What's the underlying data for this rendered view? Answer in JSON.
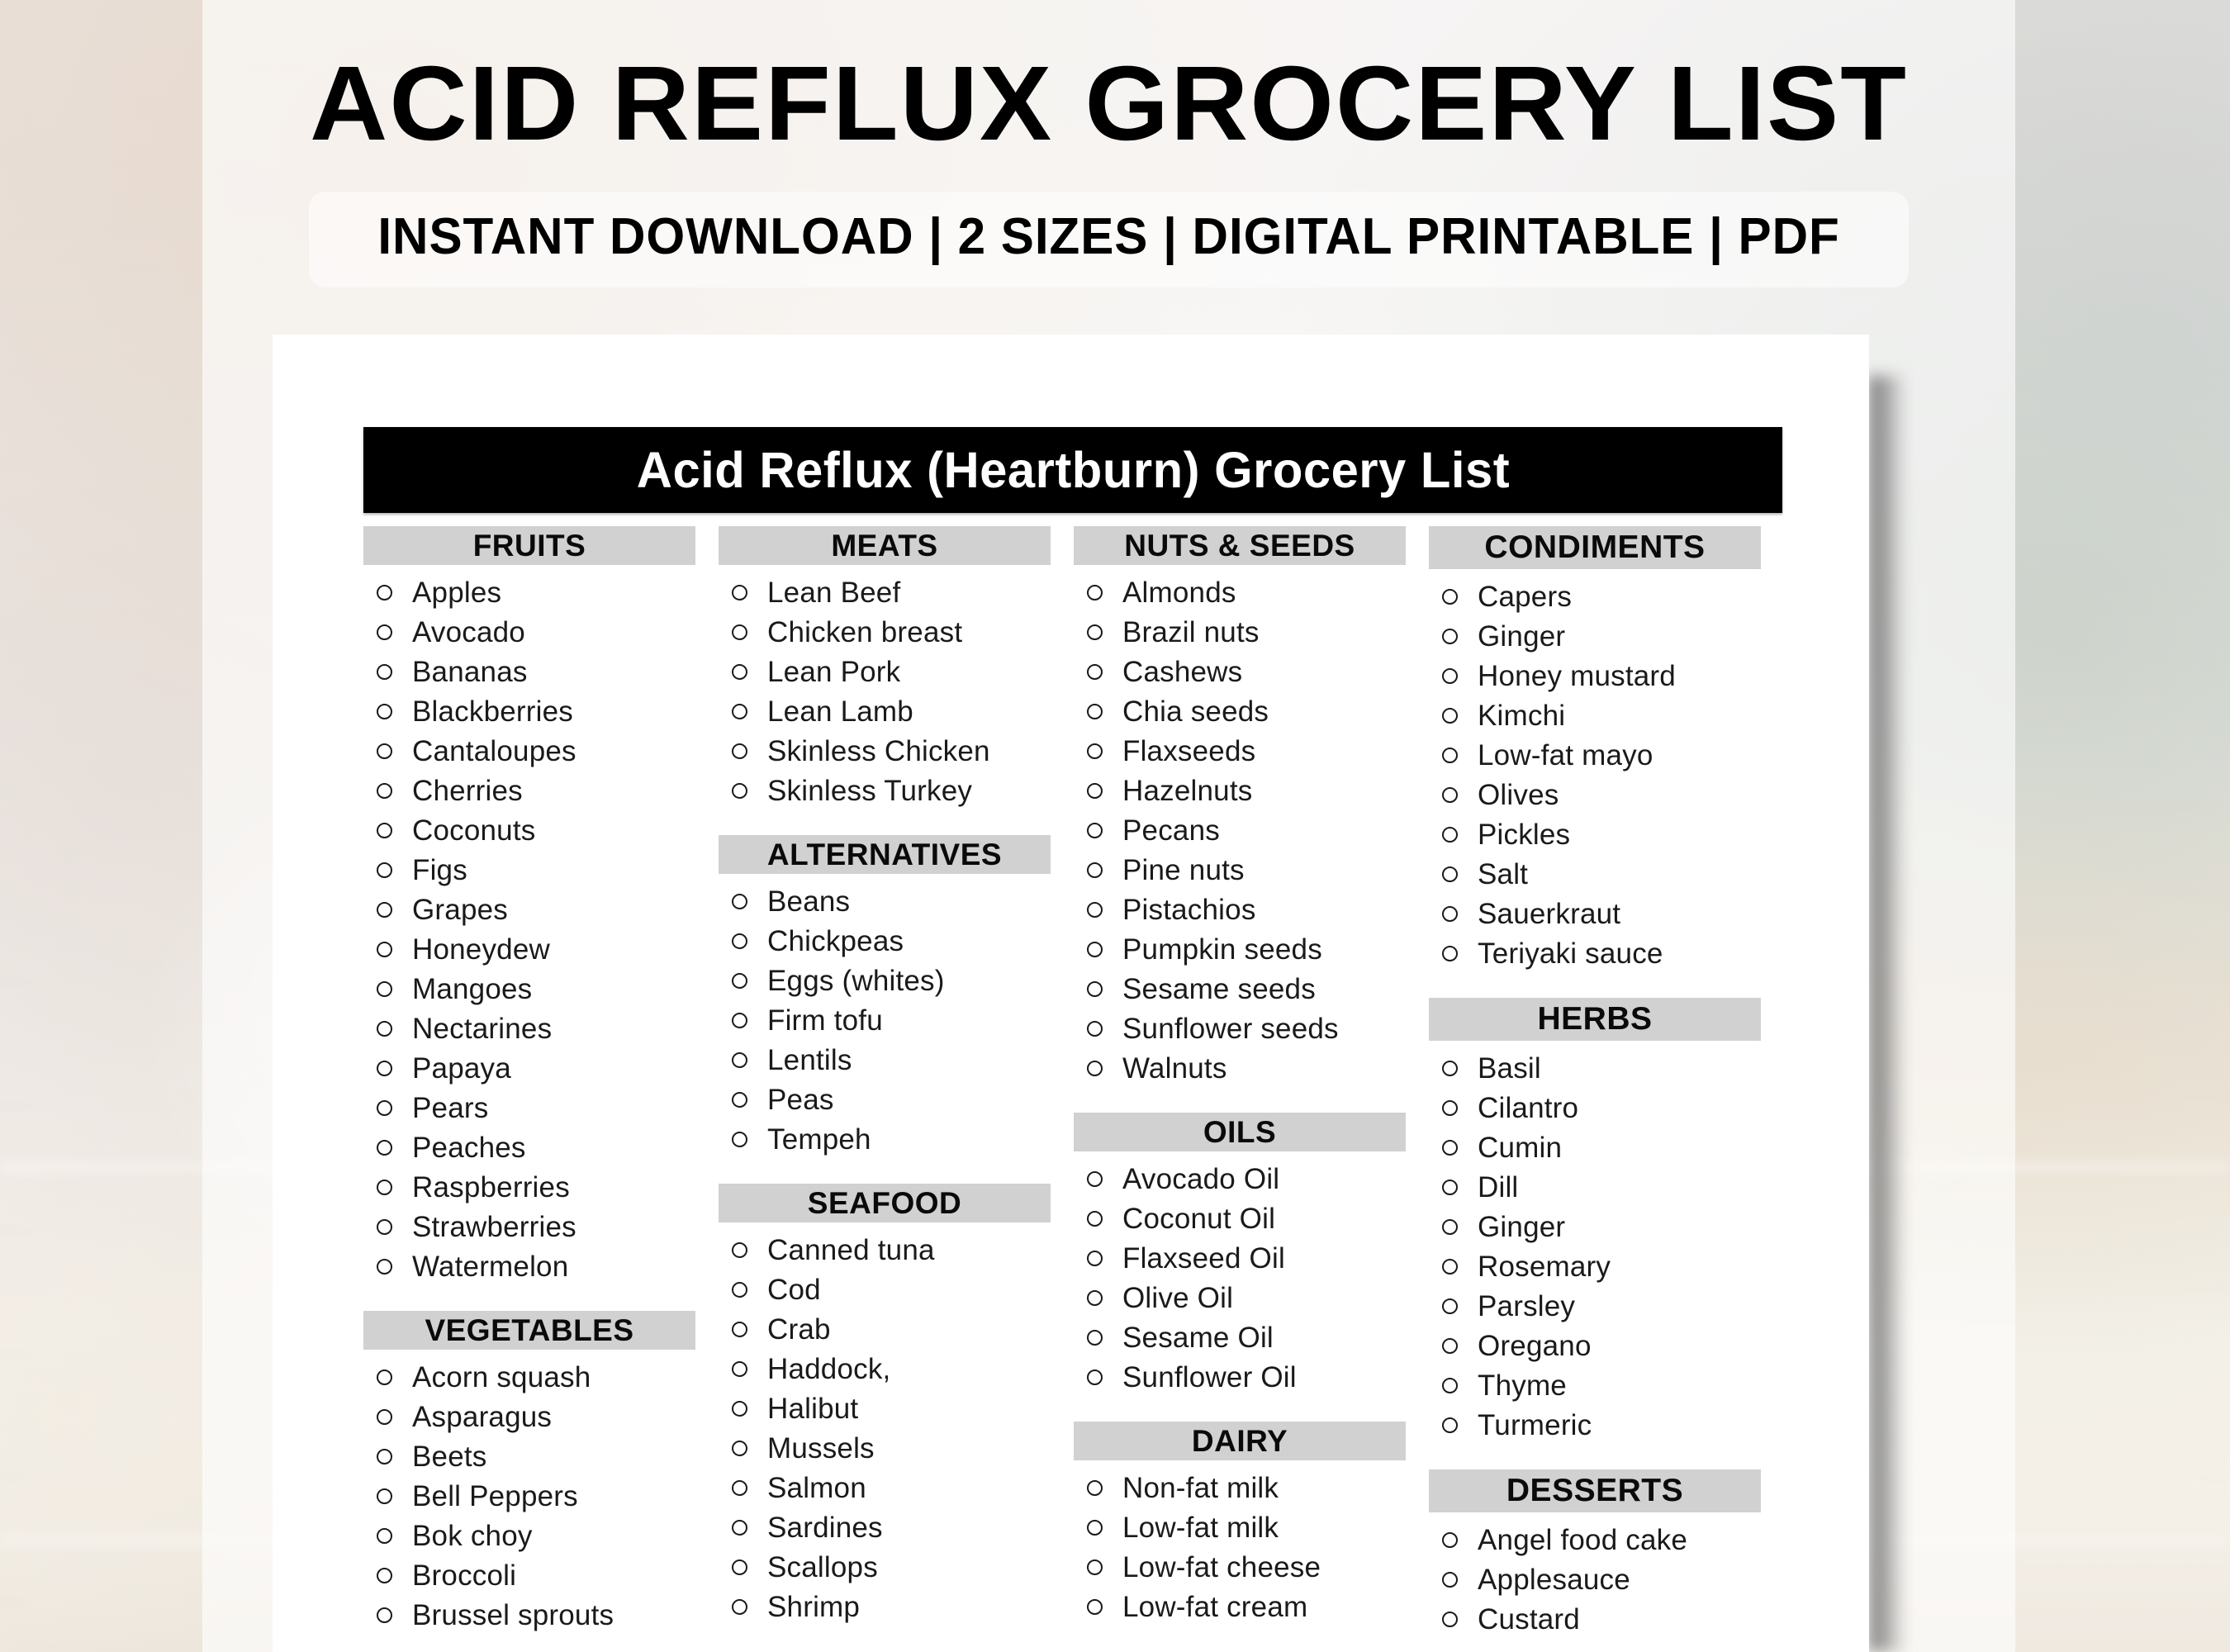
{
  "promo": {
    "title": "ACID REFLUX GROCERY LIST",
    "subtitle": "INSTANT DOWNLOAD | 2 SIZES | DIGITAL PRINTABLE | PDF"
  },
  "printable": {
    "doc_title": "Acid Reflux (Heartburn) Grocery List",
    "colors": {
      "title_bar_bg": "#000000",
      "title_bar_text": "#ffffff",
      "section_header_bg": "#d1d1d1",
      "text": "#1a1a1a",
      "sheet_bg": "#ffffff"
    },
    "columns": [
      {
        "id": "column-1",
        "sections": [
          {
            "id": "fruits",
            "title": "FRUITS",
            "items": [
              "Apples",
              "Avocado",
              "Bananas",
              "Blackberries",
              "Cantaloupes",
              "Cherries",
              "Coconuts",
              "Figs",
              "Grapes",
              "Honeydew",
              "Mangoes",
              "Nectarines",
              "Papaya",
              "Pears",
              "Peaches",
              "Raspberries",
              "Strawberries",
              "Watermelon"
            ]
          },
          {
            "id": "vegetables",
            "title": "VEGETABLES",
            "items": [
              "Acorn squash",
              "Asparagus",
              "Beets",
              "Bell Peppers",
              "Bok choy",
              "Broccoli",
              "Brussel sprouts"
            ]
          }
        ]
      },
      {
        "id": "column-2",
        "sections": [
          {
            "id": "meats",
            "title": "MEATS",
            "items": [
              "Lean Beef",
              "Chicken breast",
              "Lean Pork",
              "Lean Lamb",
              "Skinless Chicken",
              "Skinless Turkey"
            ]
          },
          {
            "id": "alternatives",
            "title": "ALTERNATIVES",
            "items": [
              "Beans",
              "Chickpeas",
              "Eggs (whites)",
              "Firm tofu",
              "Lentils",
              "Peas",
              "Tempeh"
            ]
          },
          {
            "id": "seafood",
            "title": "SEAFOOD",
            "items": [
              "Canned tuna",
              "Cod",
              "Crab",
              "Haddock,",
              "Halibut",
              "Mussels",
              "Salmon",
              "Sardines",
              "Scallops",
              "Shrimp"
            ]
          }
        ]
      },
      {
        "id": "column-3",
        "sections": [
          {
            "id": "nuts-and-seeds",
            "title": "NUTS & SEEDS",
            "items": [
              "Almonds",
              "Brazil nuts",
              "Cashews",
              "Chia seeds",
              "Flaxseeds",
              "Hazelnuts",
              "Pecans",
              "Pine nuts",
              "Pistachios",
              "Pumpkin seeds",
              "Sesame seeds",
              "Sunflower seeds",
              "Walnuts"
            ]
          },
          {
            "id": "oils",
            "title": "OILS",
            "items": [
              "Avocado Oil",
              "Coconut Oil",
              "Flaxseed Oil",
              "Olive Oil",
              "Sesame Oil",
              "Sunflower Oil"
            ]
          },
          {
            "id": "dairy",
            "title": "DAIRY",
            "items": [
              "Non-fat milk",
              "Low-fat milk",
              "Low-fat cheese",
              "Low-fat cream"
            ]
          }
        ]
      },
      {
        "id": "column-4",
        "sections": [
          {
            "id": "condiments",
            "title": "CONDIMENTS",
            "items": [
              "Capers",
              "Ginger",
              "Honey mustard",
              "Kimchi",
              "Low-fat mayo",
              "Olives",
              "Pickles",
              "Salt",
              "Sauerkraut",
              "Teriyaki sauce"
            ]
          },
          {
            "id": "herbs",
            "title": "HERBS",
            "items": [
              "Basil",
              "Cilantro",
              "Cumin",
              "Dill",
              "Ginger",
              "Rosemary",
              "Parsley",
              "Oregano",
              "Thyme",
              "Turmeric"
            ]
          },
          {
            "id": "desserts",
            "title": "DESSERTS",
            "items": [
              "Angel food cake",
              "Applesauce",
              "Custard"
            ]
          }
        ]
      }
    ]
  }
}
